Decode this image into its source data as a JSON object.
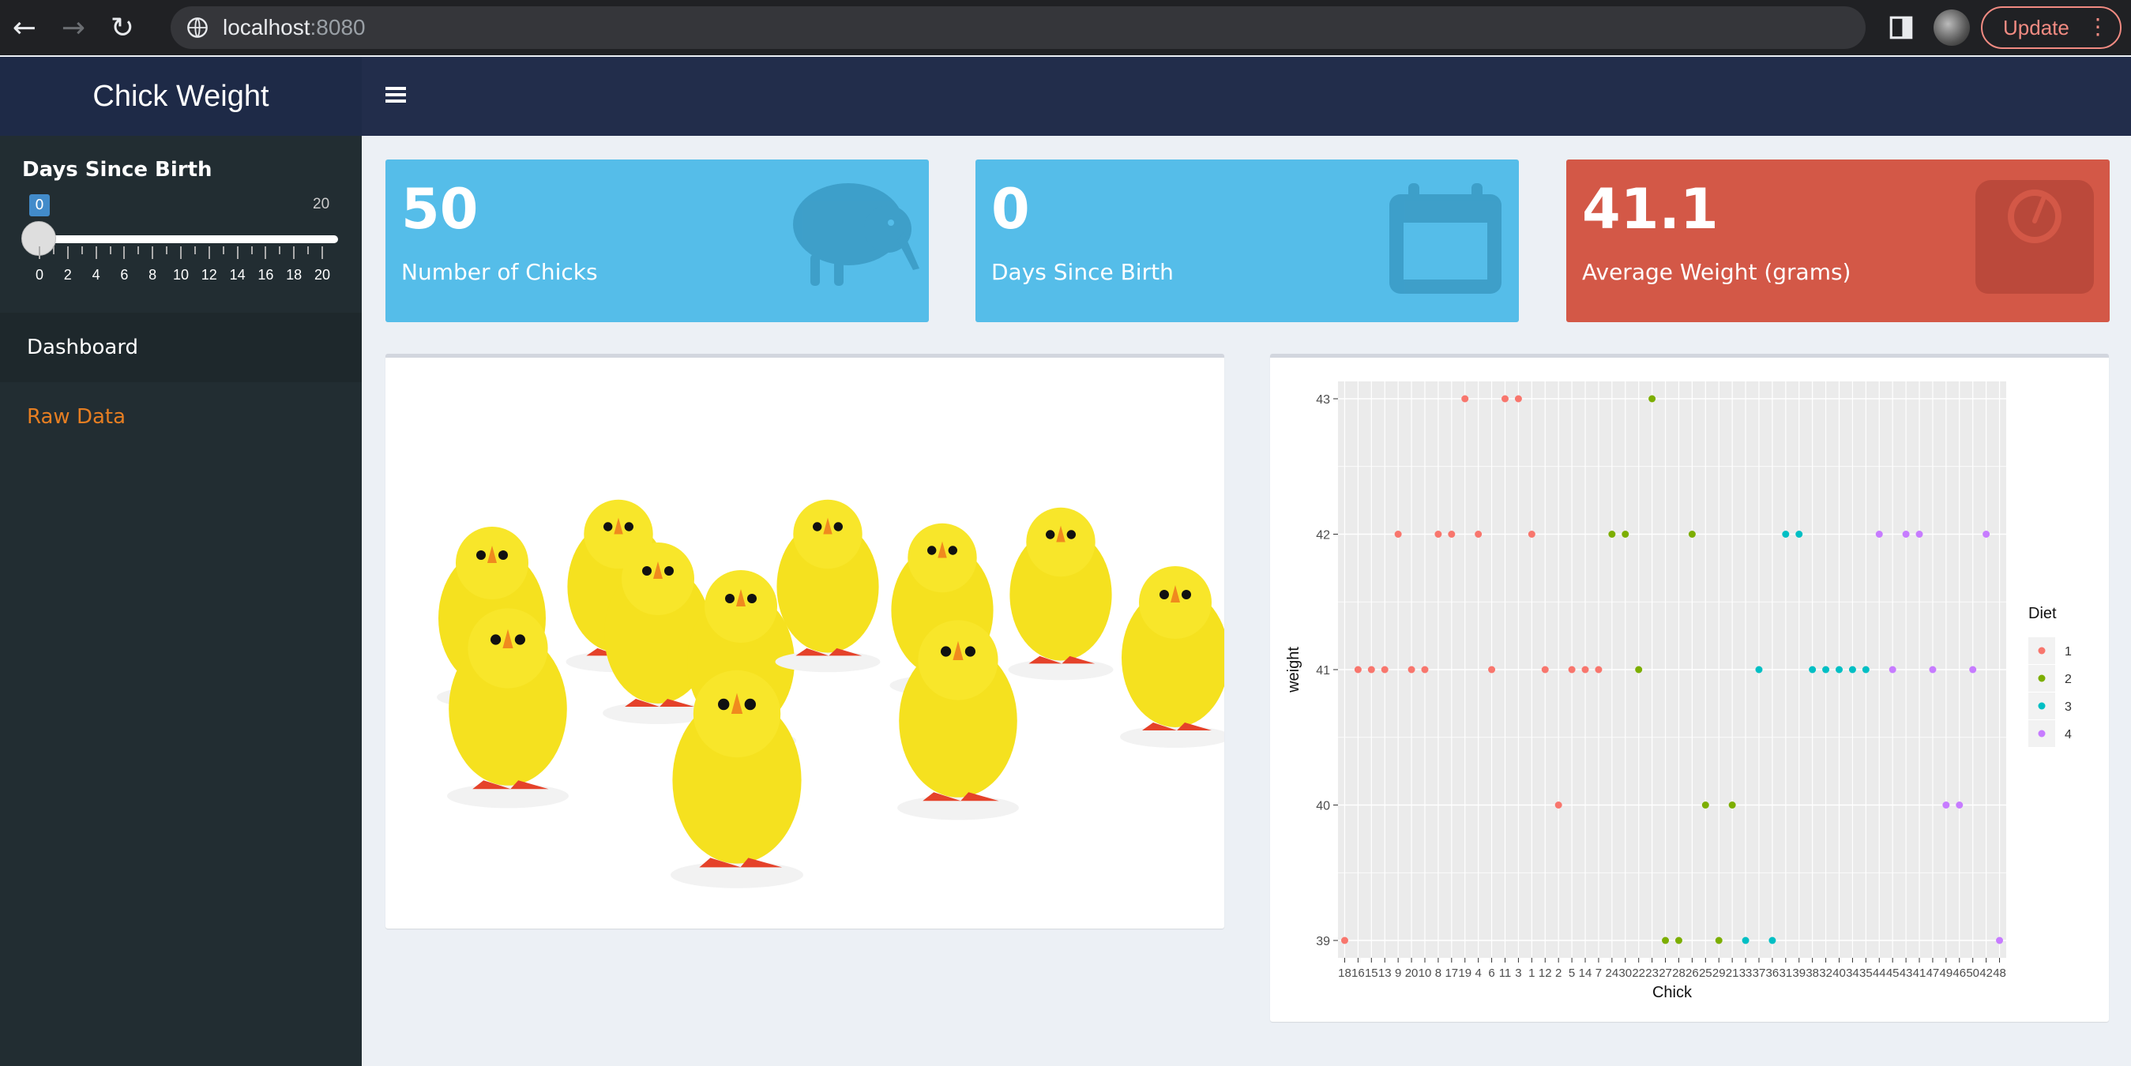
{
  "browser": {
    "url_host": "localhost",
    "url_port": ":8080",
    "update_label": "Update"
  },
  "app": {
    "title": "Chick Weight"
  },
  "sidebar": {
    "slider": {
      "label": "Days Since Birth",
      "value": "0",
      "max_label": "20",
      "min": 0,
      "max": 20,
      "ticks": [
        "0",
        "2",
        "4",
        "6",
        "8",
        "10",
        "12",
        "14",
        "16",
        "18",
        "20"
      ]
    },
    "menu": [
      {
        "label": "Dashboard",
        "active": true
      },
      {
        "label": "Raw Data",
        "active": false
      }
    ]
  },
  "value_boxes": [
    {
      "value": "50",
      "label": "Number of Chicks",
      "icon": "kiwi-bird-icon",
      "color": "#55bde9"
    },
    {
      "value": "0",
      "label": "Days Since Birth",
      "icon": "calendar-icon",
      "color": "#55bde9"
    },
    {
      "value": "41.1",
      "label": "Average Weight (grams)",
      "icon": "weight-scale-icon",
      "color": "#d35847"
    }
  ],
  "image_panel": {
    "image": "yellow-toy-chicks"
  },
  "chart_data": {
    "type": "scatter",
    "xlabel": "Chick",
    "ylabel": "weight",
    "ylim": [
      39,
      43
    ],
    "yticks": [
      39,
      40,
      41,
      42,
      43
    ],
    "legend_title": "Diet",
    "legend_position": "right",
    "grid": true,
    "diet_colors": {
      "1": "#f8766d",
      "2": "#7cae00",
      "3": "#00bfc4",
      "4": "#c77cff"
    },
    "categories": [
      "18",
      "16",
      "15",
      "13",
      "9",
      "20",
      "10",
      "8",
      "17",
      "19",
      "4",
      "6",
      "11",
      "3",
      "1",
      "12",
      "2",
      "5",
      "14",
      "7",
      "24",
      "30",
      "22",
      "23",
      "27",
      "28",
      "26",
      "25",
      "29",
      "21",
      "33",
      "37",
      "36",
      "31",
      "39",
      "38",
      "32",
      "40",
      "34",
      "35",
      "44",
      "45",
      "43",
      "41",
      "47",
      "49",
      "46",
      "50",
      "42",
      "48"
    ],
    "series": [
      {
        "name": "1",
        "x": [
          "18",
          "16",
          "15",
          "13",
          "9",
          "20",
          "10",
          "8",
          "17",
          "19",
          "4",
          "6",
          "11",
          "3",
          "1",
          "12",
          "2",
          "5",
          "14",
          "7"
        ],
        "y": [
          39,
          41,
          41,
          41,
          42,
          41,
          41,
          42,
          42,
          43,
          42,
          41,
          43,
          43,
          42,
          41,
          40,
          41,
          41,
          41
        ]
      },
      {
        "name": "2",
        "x": [
          "24",
          "30",
          "22",
          "23",
          "27",
          "28",
          "26",
          "25",
          "29",
          "21"
        ],
        "y": [
          42,
          42,
          41,
          43,
          39,
          39,
          42,
          40,
          39,
          40
        ]
      },
      {
        "name": "3",
        "x": [
          "33",
          "37",
          "36",
          "31",
          "39",
          "38",
          "32",
          "40",
          "34",
          "35"
        ],
        "y": [
          39,
          41,
          39,
          42,
          42,
          41,
          41,
          41,
          41,
          41
        ]
      },
      {
        "name": "4",
        "x": [
          "44",
          "45",
          "43",
          "41",
          "47",
          "49",
          "46",
          "50",
          "42",
          "48"
        ],
        "y": [
          42,
          41,
          42,
          42,
          41,
          40,
          40,
          41,
          42,
          39
        ]
      }
    ]
  }
}
